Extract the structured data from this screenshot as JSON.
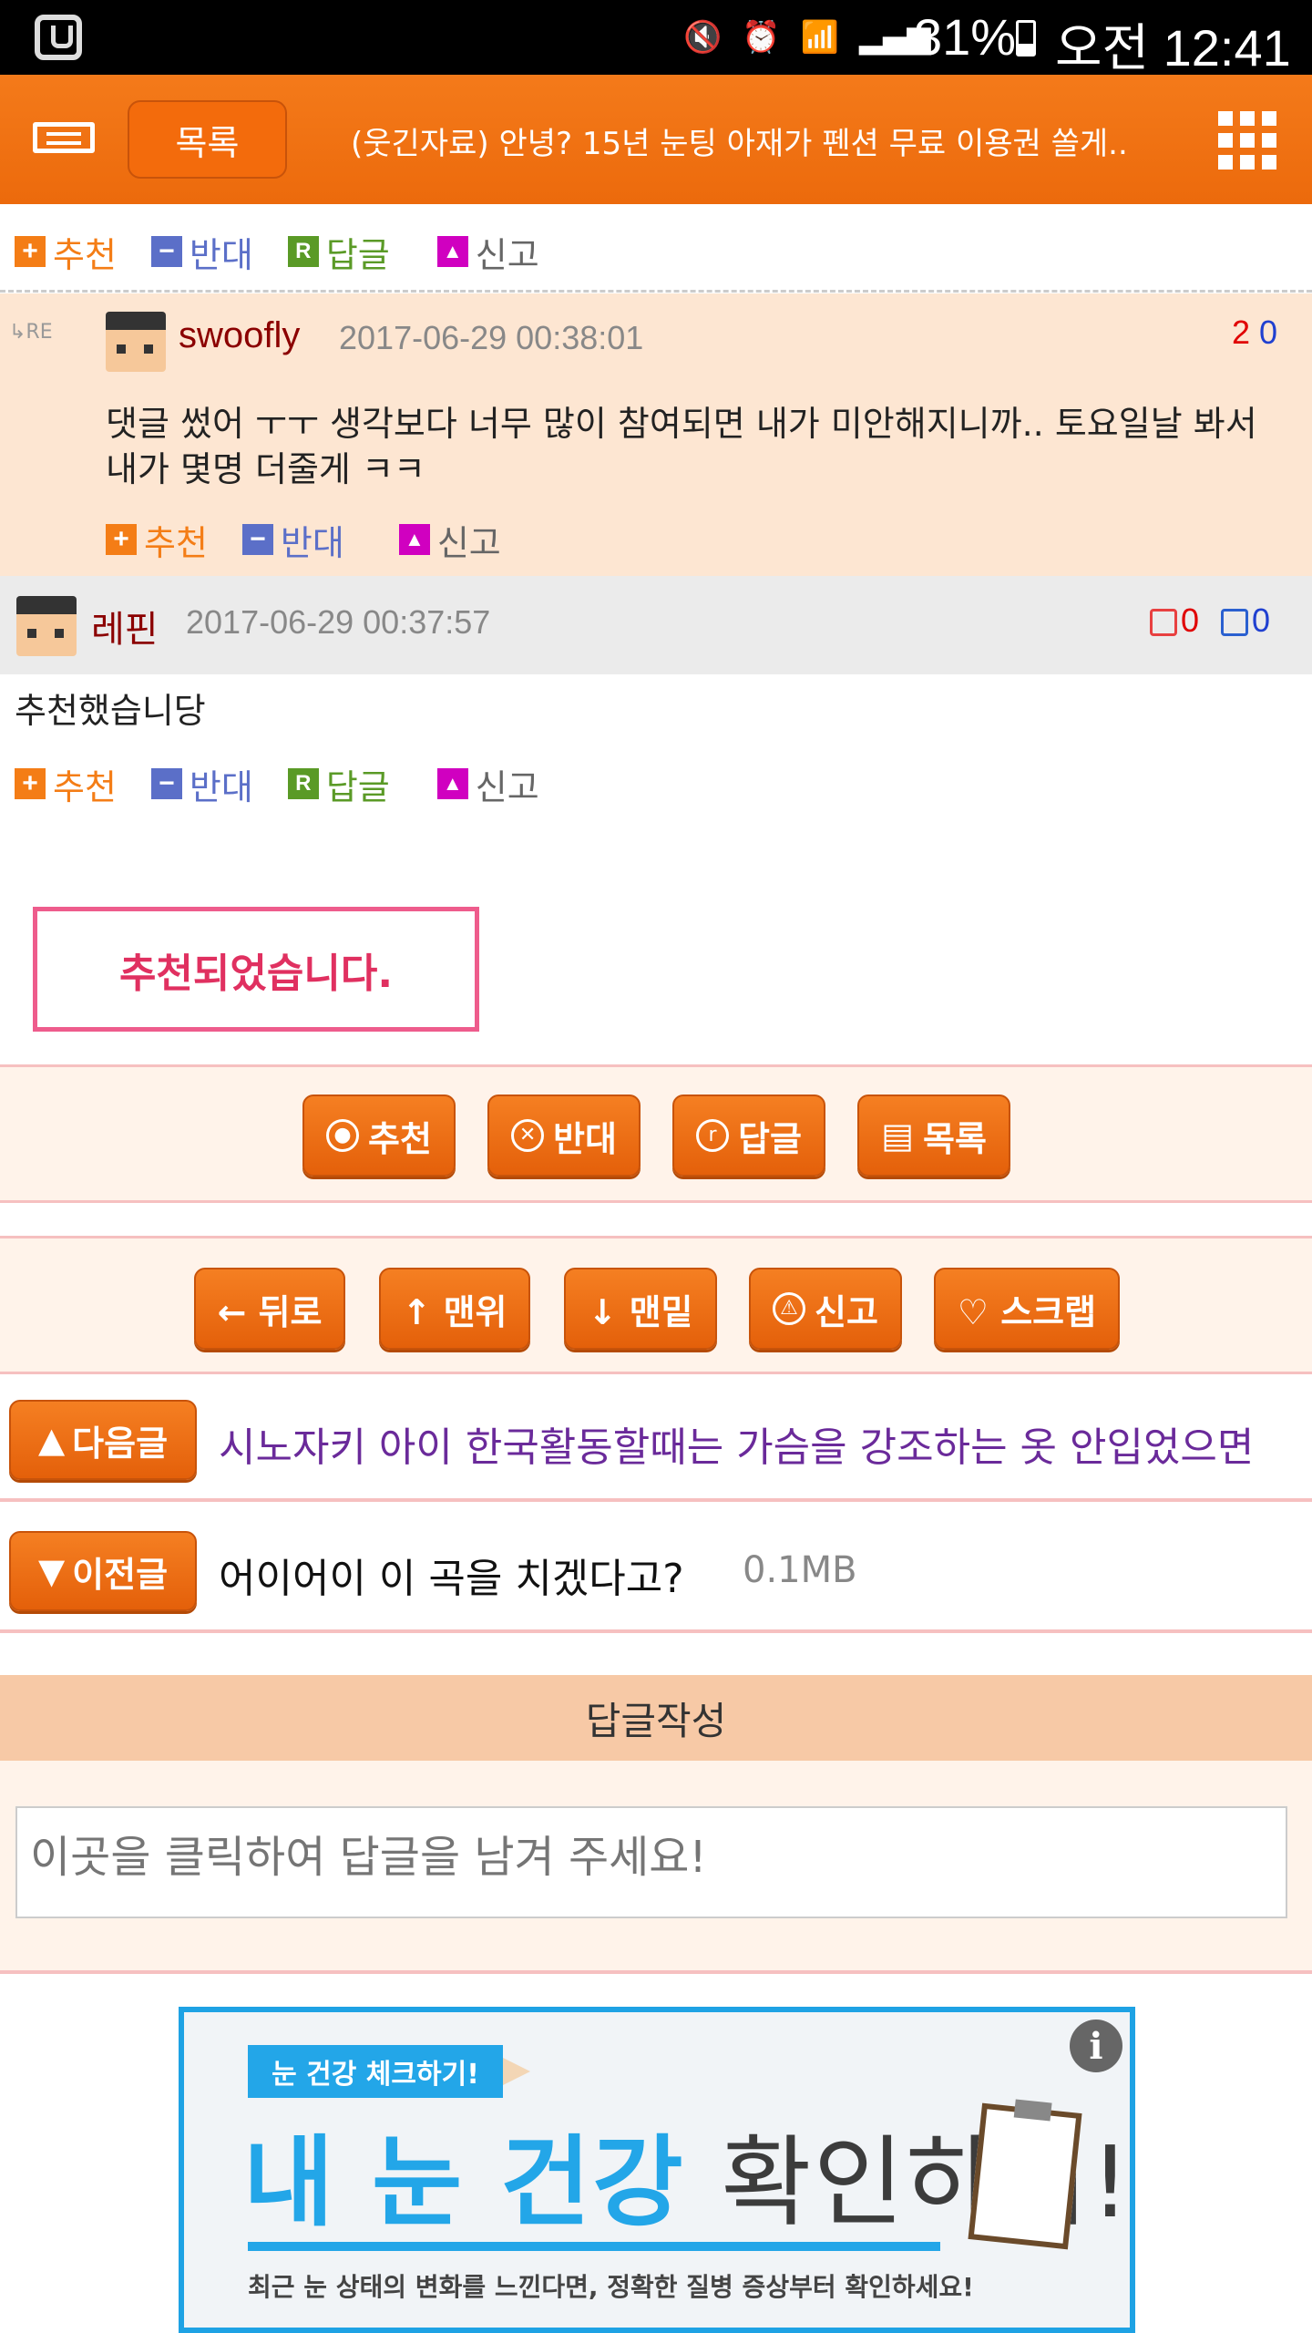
{
  "status_bar": {
    "battery": "31%",
    "time": "오전 12:41"
  },
  "header": {
    "list_button": "목록",
    "title": "(웃긴자료) 안녕? 15년 눈팅 아재가 펜션 무료 이용권 쏠게.."
  },
  "actions": {
    "recommend": "추천",
    "oppose": "반대",
    "reply": "답글",
    "report": "신고"
  },
  "comments": [
    {
      "user": "swoofly",
      "date": "2017-06-29 00:38:01",
      "up": "2",
      "down": "0",
      "text": "댓글 썼어 ㅜㅜ 생각보다 너무 많이 참여되면 내가 미안해지니까.. 토요일날 봐서 내가 몇명 더줄게 ㅋㅋ"
    },
    {
      "user": "레핀",
      "date": "2017-06-29 00:37:57",
      "up": "0",
      "down": "0",
      "text": "추천했습니당"
    }
  ],
  "notice": "추천되었습니다.",
  "post_buttons": [
    "추천",
    "반대",
    "답글",
    "목록"
  ],
  "nav_buttons": [
    "← 뒤로",
    "↑ 맨위",
    "↓ 맨밑",
    "신고",
    "♡ 스크랩"
  ],
  "next_post": {
    "label": "다음글",
    "title": "시노자키 아이 한국활동할때는 가슴을 강조하는 옷 안입었으면"
  },
  "prev_post": {
    "label": "이전글",
    "title": "어이어이 이 곡을 치겠다고?",
    "size": "0.1MB"
  },
  "reply_form": {
    "title": "답글작성",
    "placeholder": "이곳을 클릭하여 답글을 남겨 주세요!"
  },
  "ad": {
    "tag": "눈 건강 체크하기!",
    "headline_blue": "내 눈 건강",
    "headline_dark": "확인하기!",
    "sub": "최근 눈 상태의 변화를 느낀다면, 정확한 질병 증상부터 확인하세요!",
    "info": "i"
  },
  "colors": {
    "accent": "#f47a1a",
    "recommend": "#f47d16",
    "oppose": "#5b6fc8",
    "reply": "#5a9a26",
    "notice": "#e03060",
    "next_title": "#6a2a9a"
  }
}
